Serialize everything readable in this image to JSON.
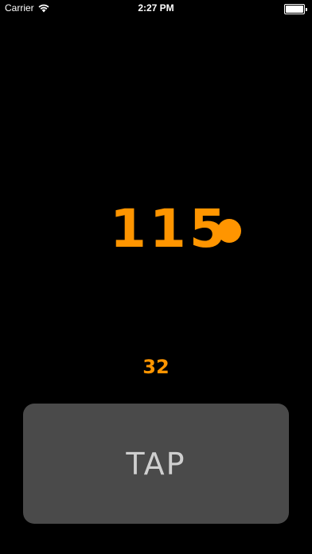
{
  "status_bar": {
    "carrier": "Carrier",
    "time": "2:27 PM",
    "wifi_icon": "wifi-icon",
    "battery_icon": "battery-icon",
    "battery_level": 1.0
  },
  "tempo": {
    "value": "115",
    "indicator_icon": "beat-dot-icon"
  },
  "tap_count": "32",
  "tap_button": {
    "label": "TAP"
  },
  "colors": {
    "accent": "#ff9500",
    "background": "#000000",
    "button_bg": "#4a4a4a",
    "button_text": "#cfcfcf"
  }
}
